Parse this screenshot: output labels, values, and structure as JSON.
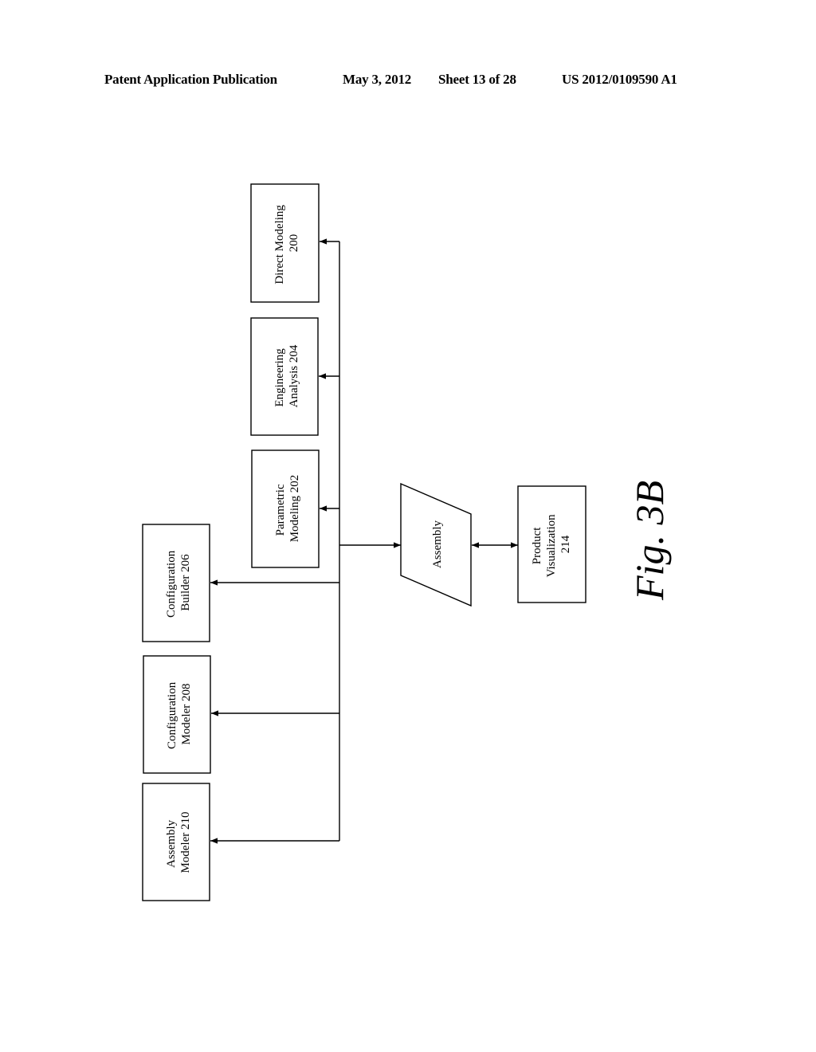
{
  "header": {
    "publication": "Patent Application Publication",
    "date": "May 3, 2012",
    "sheet": "Sheet 13 of 28",
    "number": "US 2012/0109590 A1"
  },
  "figure_label": "Fig. 3B",
  "diagram": {
    "nodes": {
      "direct_modeling": [
        "Direct Modeling",
        "200"
      ],
      "engineering_analysis": [
        "Engineering",
        "Analysis 204"
      ],
      "parametric_modeling": [
        "Parametric",
        "Modeling 202"
      ],
      "configuration_builder": [
        "Configuration",
        "Builder 206"
      ],
      "configuration_modeler": [
        "Configuration",
        "Modeler 208"
      ],
      "assembly_modeler": [
        "Assembly",
        "Modeler 210"
      ],
      "assembly": [
        "Assembly"
      ],
      "product_visualization": [
        "Product",
        "Visualization",
        "214"
      ]
    },
    "edges": [
      {
        "from": "assembly",
        "to": "direct_modeling",
        "type": "arrow"
      },
      {
        "from": "assembly",
        "to": "engineering_analysis",
        "type": "arrow"
      },
      {
        "from": "assembly",
        "to": "parametric_modeling",
        "type": "arrow"
      },
      {
        "from": "assembly",
        "to": "configuration_builder",
        "type": "arrow"
      },
      {
        "from": "assembly",
        "to": "configuration_modeler",
        "type": "arrow"
      },
      {
        "from": "assembly",
        "to": "assembly_modeler",
        "type": "arrow"
      },
      {
        "from": "trunk",
        "to": "assembly",
        "type": "arrow"
      },
      {
        "from": "assembly",
        "to": "product_visualization",
        "type": "bidirectional"
      }
    ]
  }
}
